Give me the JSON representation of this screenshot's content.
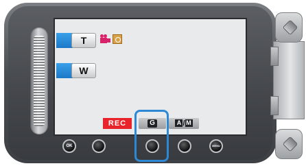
{
  "zoom": {
    "tele_label": "T",
    "wide_label": "W"
  },
  "mode_icons": [
    "movie-camera-icon",
    "still-photo-icon"
  ],
  "soft_labels": {
    "rec_label": "REC",
    "g_label": "G",
    "auto_manual": {
      "a": "A",
      "sep": "/",
      "m": "M"
    }
  },
  "hard_buttons": {
    "ok_label": "OK",
    "menu_label": "MENU"
  },
  "highlighted_button": "third-button",
  "colors": {
    "accent_blue": "#2d88d6",
    "rec_red": "#e8232a",
    "movie_pink": "#d8226a",
    "photo_orange": "#d9a24a"
  }
}
